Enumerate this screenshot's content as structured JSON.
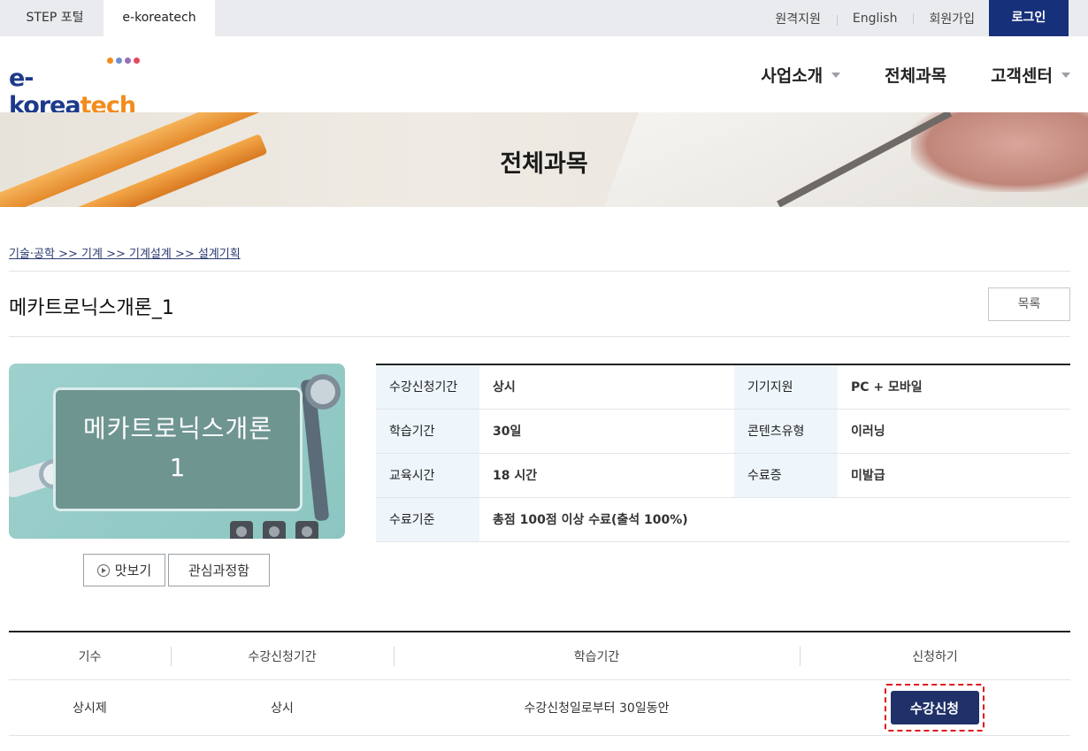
{
  "topbar": {
    "tabs": [
      {
        "label": "STEP 포털"
      },
      {
        "label": "e-koreatech"
      }
    ],
    "links": [
      "원격지원",
      "English",
      "회원가입"
    ],
    "login_label": "로그인"
  },
  "header": {
    "logo": {
      "part1": "e-korea",
      "part2": "tech",
      "dot_colors": [
        "#f28c1c",
        "#6f8fd1",
        "#9c6fb5",
        "#e1495e"
      ]
    },
    "nav": [
      {
        "label": "사업소개",
        "has_caret": true
      },
      {
        "label": "전체과목",
        "has_caret": false
      },
      {
        "label": "고객센터",
        "has_caret": true
      }
    ]
  },
  "banner": {
    "title": "전체과목"
  },
  "breadcrumb": "기술·공학 >> 기계 >> 기계설계 >> 설계기획",
  "course": {
    "title": "메카트로닉스개론_1",
    "list_button": "목록",
    "thumbnail": {
      "line1": "메카트로닉스개론",
      "line2": "1"
    },
    "preview_label": "맛보기",
    "favorite_label": "관심과정함"
  },
  "info": {
    "enroll_period_label": "수강신청기간",
    "enroll_period": "상시",
    "device_label": "기기지원",
    "device": "PC + 모바일",
    "study_period_label": "학습기간",
    "study_period": "30일",
    "content_type_label": "콘텐츠유형",
    "content_type": "이러닝",
    "edu_time_label": "교육시간",
    "edu_time": "18 시간",
    "certificate_label": "수료증",
    "certificate": "미발급",
    "completion_label": "수료기준",
    "completion": "총점 100점 이상 수료(출석 100%)"
  },
  "sessions": {
    "headers": [
      "기수",
      "수강신청기간",
      "학습기간",
      "신청하기"
    ],
    "rows": [
      {
        "term": "상시제",
        "enroll": "상시",
        "study": "수강신청일로부터 30일동안",
        "apply_label": "수강신청"
      }
    ]
  },
  "colors": {
    "navy": "#17307a",
    "apply": "#1f3168",
    "highlight": "#e0141c",
    "info_header_bg": "#eef6fb"
  }
}
